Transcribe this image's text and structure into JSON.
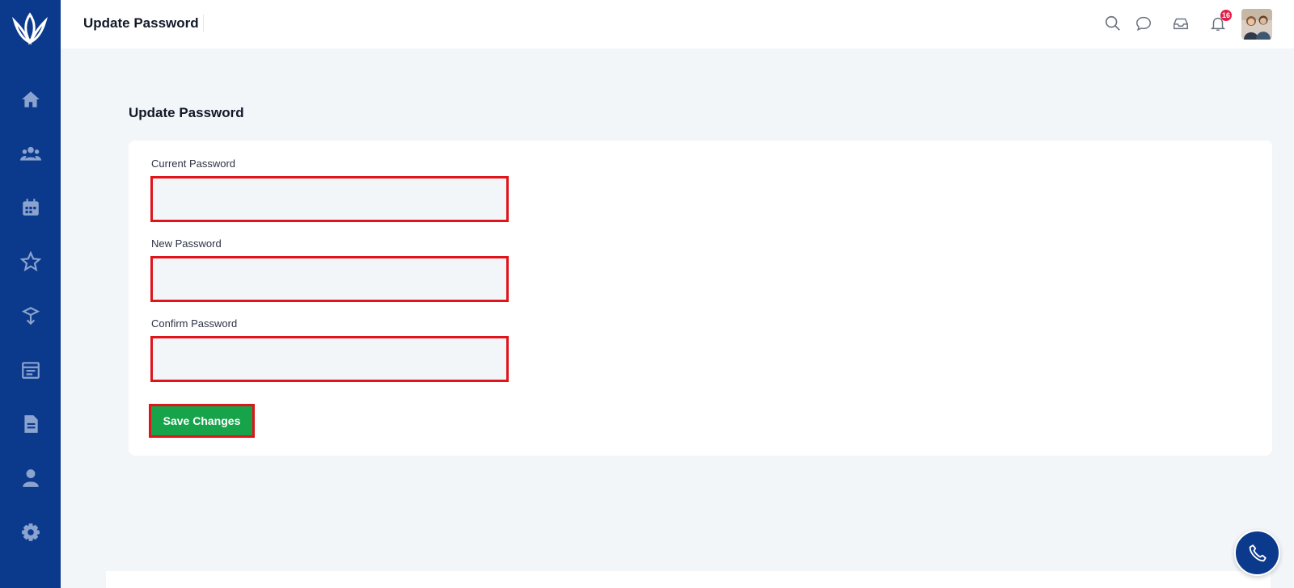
{
  "app": {
    "header_title": "Update Password",
    "notification_count": "16",
    "brand_color": "#0b3a8c"
  },
  "sidebar": {
    "items": [
      {
        "icon": "home-icon"
      },
      {
        "icon": "users-icon"
      },
      {
        "icon": "calendar-icon"
      },
      {
        "icon": "star-icon"
      },
      {
        "icon": "box-icon"
      },
      {
        "icon": "calendar-list-icon"
      },
      {
        "icon": "document-icon"
      },
      {
        "icon": "user-icon"
      },
      {
        "icon": "gear-icon"
      }
    ]
  },
  "topbar_icons": [
    "search-icon",
    "chat-icon",
    "inbox-icon",
    "bell-icon"
  ],
  "form": {
    "heading": "Update Password",
    "current_password_label": "Current Password",
    "current_password_value": "",
    "new_password_label": "New Password",
    "new_password_value": "",
    "confirm_password_label": "Confirm Password",
    "confirm_password_value": "",
    "save_label": "Save Changes",
    "error_border_color": "#e0141a",
    "save_color": "#16a34a"
  }
}
